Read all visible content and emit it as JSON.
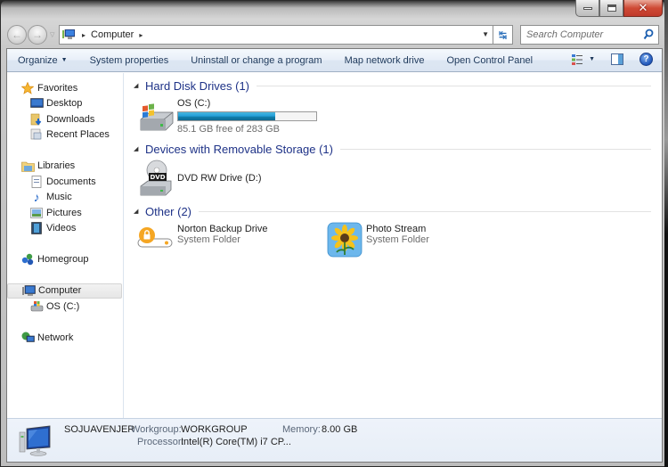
{
  "window": {
    "caption_buttons": {
      "minimize": "minimize",
      "maximize": "maximize",
      "close": "close"
    }
  },
  "nav": {
    "back_icon": "back-arrow-icon",
    "forward_icon": "forward-arrow-icon",
    "address": {
      "crumbs": [
        "Computer"
      ],
      "separator_glyph": "▸"
    },
    "search_placeholder": "Search Computer"
  },
  "toolbar": {
    "organize": "Organize",
    "system_properties": "System properties",
    "uninstall": "Uninstall or change a program",
    "map_drive": "Map network drive",
    "control_panel": "Open Control Panel"
  },
  "sidebar": {
    "favorites": {
      "label": "Favorites",
      "items": [
        "Desktop",
        "Downloads",
        "Recent Places"
      ]
    },
    "libraries": {
      "label": "Libraries",
      "items": [
        "Documents",
        "Music",
        "Pictures",
        "Videos"
      ]
    },
    "homegroup": {
      "label": "Homegroup"
    },
    "computer": {
      "label": "Computer",
      "items": [
        "OS (C:)"
      ],
      "selected": true
    },
    "network": {
      "label": "Network"
    }
  },
  "content": {
    "groups": [
      {
        "title": "Hard Disk Drives (1)",
        "items": [
          {
            "name": "OS (C:)",
            "free_text": "85.1 GB free of 283 GB",
            "used_fraction": 0.7
          }
        ]
      },
      {
        "title": "Devices with Removable Storage (1)",
        "items": [
          {
            "name": "DVD RW Drive (D:)",
            "badge": "DVD"
          }
        ]
      },
      {
        "title": "Other (2)",
        "items": [
          {
            "name": "Norton Backup Drive",
            "type": "System Folder"
          },
          {
            "name": "Photo Stream",
            "type": "System Folder"
          }
        ]
      }
    ]
  },
  "details": {
    "computer_name": "SOJUAVENJER",
    "workgroup_label": "Workgroup:",
    "workgroup_value": "WORKGROUP",
    "memory_label": "Memory:",
    "memory_value": "8.00 GB",
    "processor_label": "Processor:",
    "processor_value": "Intel(R) Core(TM) i7 CP..."
  },
  "colors": {
    "group_title": "#1e3287",
    "toolbar_text": "#1e395b",
    "progress_fill": "#26a0da",
    "close_button": "#c0392b"
  }
}
